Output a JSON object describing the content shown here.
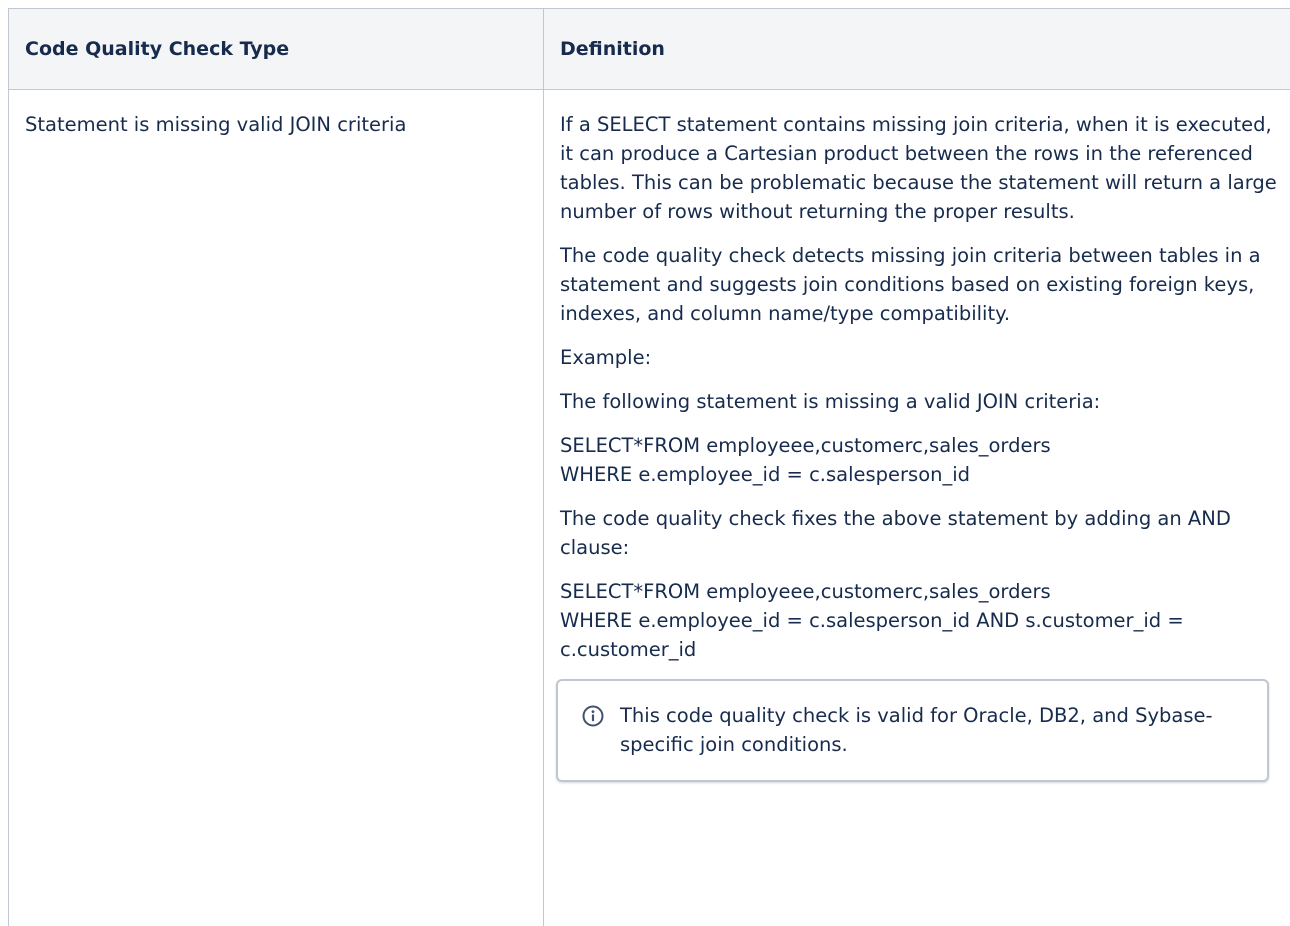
{
  "table": {
    "headers": {
      "type": "Code Quality Check Type",
      "definition": "Definition"
    },
    "row": {
      "type": "Statement is missing valid JOIN criteria",
      "paragraphs": {
        "p1": "If a SELECT statement contains missing join criteria, when it is executed, it can produce a Cartesian product between the rows in the referenced tables. This can be problematic because the statement will return a large number of rows without returning the proper results.",
        "p2": "The code quality check detects missing join criteria between tables in a statement and suggests join conditions based on existing foreign keys, indexes, and column name/type compatibility.",
        "p3": "Example:",
        "p4": "The following statement is missing a valid JOIN criteria:",
        "code1_line1": "SELECT*FROM employeee,customerc,sales_orders",
        "code1_line2": "WHERE e.employee_id = c.salesperson_id",
        "p5": "The code quality check fixes the above statement by adding an AND clause:",
        "code2_line1": "SELECT*FROM employeee,customerc,sales_orders",
        "code2_line2": "WHERE e.employee_id = c.salesperson_id AND s.customer_id = c.customer_id"
      },
      "info_panel": {
        "icon": "info-icon",
        "text": "This code quality check is valid for Oracle, DB2, and Sybase-specific join conditions."
      }
    }
  },
  "colors": {
    "text": "#172b4d",
    "header_bg": "#f4f5f7",
    "border": "#c1c7d0"
  }
}
